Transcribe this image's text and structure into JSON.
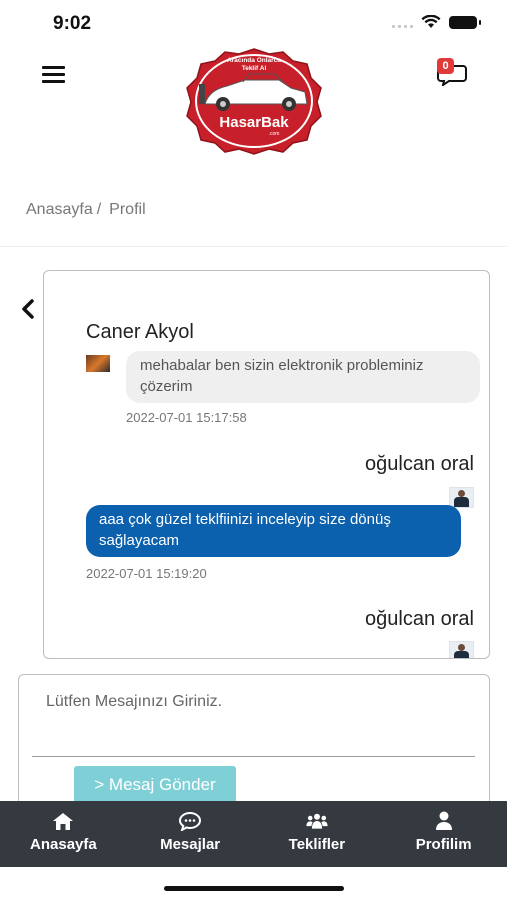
{
  "status_bar": {
    "time": "9:02"
  },
  "header": {
    "logo": {
      "top_text": "Aracında Onlarca",
      "sub_text": "Teklif Al",
      "brand": "HasarBak",
      "domain": ".com"
    },
    "message_badge": "0"
  },
  "breadcrumb": {
    "home": "Anasayfa",
    "separator": "/",
    "current": "Profil"
  },
  "chat": {
    "messages": [
      {
        "sender": "Caner Akyol",
        "text": "mehabalar ben sizin elektronik probleminiz çözerim",
        "time": "2022-07-01 15:17:58",
        "side": "left"
      },
      {
        "sender": "oğulcan oral",
        "text": "aaa çok güzel teklfiinizi inceleyip size dönüş sağlayacam",
        "time": "2022-07-01 15:19:20",
        "side": "right"
      },
      {
        "sender": "oğulcan oral",
        "side": "right"
      }
    ]
  },
  "composer": {
    "placeholder": "Lütfen Mesajınızı Giriniz.",
    "send_label": "> Mesaj Gönder"
  },
  "tabbar": {
    "items": [
      {
        "label": "Anasayfa",
        "icon": "home-icon"
      },
      {
        "label": "Mesajlar",
        "icon": "chat-icon"
      },
      {
        "label": "Teklifler",
        "icon": "users-icon"
      },
      {
        "label": "Profilim",
        "icon": "user-icon"
      }
    ]
  },
  "colors": {
    "accent_blue": "#0b61ad",
    "send_button": "#7fd0d6",
    "tab_bar": "#343a40",
    "brand_red": "#c8202a",
    "badge_red": "#e03a3a"
  }
}
